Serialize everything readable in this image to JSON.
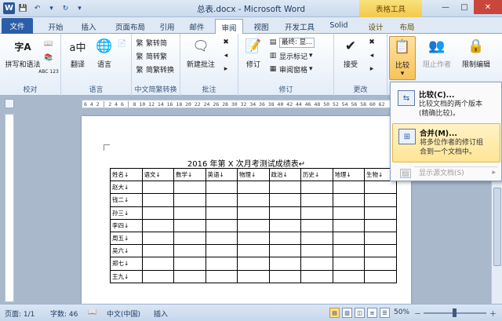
{
  "window": {
    "title": "总表.docx - Microsoft Word",
    "context_tab_group": "表格工具",
    "minimize": "—",
    "maximize": "□",
    "close": "✕"
  },
  "tabs": [
    {
      "label": "文件"
    },
    {
      "label": "开始"
    },
    {
      "label": "插入"
    },
    {
      "label": "页面布局"
    },
    {
      "label": "引用"
    },
    {
      "label": "邮件"
    },
    {
      "label": "审阅"
    },
    {
      "label": "视图"
    },
    {
      "label": "开发工具"
    },
    {
      "label": "Solid"
    },
    {
      "label": "设计"
    },
    {
      "label": "布局"
    }
  ],
  "ribbon": {
    "proofing": {
      "label": "校对",
      "spelling": "拼写和语法",
      "spelling_icon_text": "字A",
      "abc_icon_text": "ABC 123"
    },
    "language": {
      "label": "语言",
      "translate": "翻译",
      "language": "语言",
      "translate_icon_text": "a中"
    },
    "chinese_conv": {
      "label": "中文简繁转换",
      "to_simplified": "繁转简",
      "to_traditional": "简转繁",
      "convert": "简繁转换"
    },
    "comments": {
      "label": "批注",
      "new_comment": "新建批注"
    },
    "tracking": {
      "label": "修订",
      "track_changes": "修订",
      "display_mode": "最终: 显...",
      "show_markup": "显示标记",
      "reviewing_pane": "审阅窗格"
    },
    "changes": {
      "label": "更改",
      "accept": "接受"
    },
    "compare": {
      "compare": "比较",
      "block_authors": "阻止作者",
      "restrict_editing": "限制编辑"
    }
  },
  "compare_menu": {
    "compare_title": "比较(C)...",
    "compare_desc_1": "比较文档的两个版本",
    "compare_desc_2": "(精确比较)。",
    "combine_title": "合并(M)...",
    "combine_desc_1": "将多位作者的修订组",
    "combine_desc_2": "合到一个文档中。",
    "show_source": "显示源文档(S)",
    "submenu_arrow": "▸"
  },
  "ruler": {
    "text": "6 4 2 │ 2 4 6 │ 8 10 12 14 16 18 20 22 24 26 28 30 32 34 36 38 40 42 44 46 48 50 52 54 56 58 60 62"
  },
  "document": {
    "title": "2016 年第 X 次月考测试成绩表↵",
    "table_header": [
      "姓名↓",
      "语文↓",
      "数学↓",
      "英语↓",
      "物理↓",
      "政治↓",
      "历史↓",
      "地理↓",
      "生物↓"
    ],
    "students": [
      "赵大↓",
      "钱二↓",
      "孙三↓",
      "李四↓",
      "周五↓",
      "吴六↓",
      "郑七↓",
      "王九↓"
    ]
  },
  "statusbar": {
    "page": "页面: 1/1",
    "words": "字数: 46",
    "language": "中文(中国)",
    "insert_mode": "插入",
    "zoom": "50%",
    "zoom_minus": "－",
    "zoom_plus": "＋"
  }
}
